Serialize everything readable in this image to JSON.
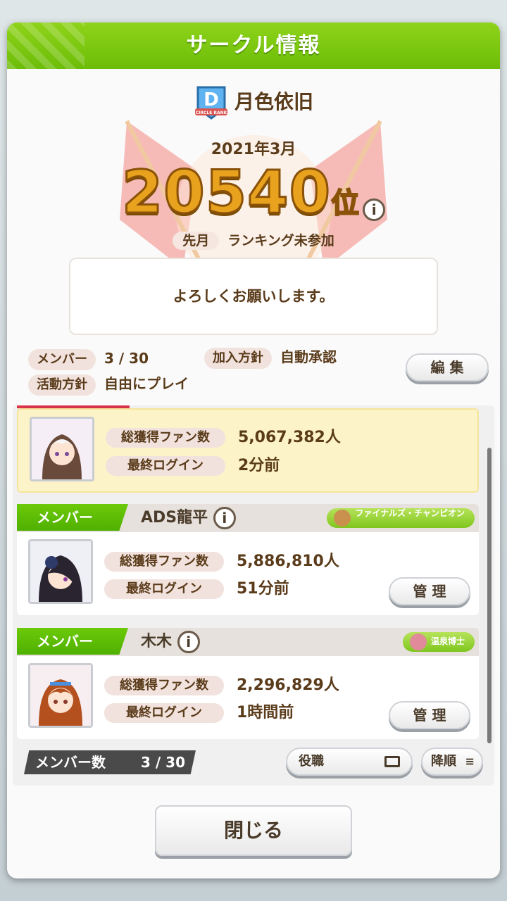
{
  "header": {
    "title": "サークル情報"
  },
  "circle": {
    "rank_badge": "D",
    "rank_badge_caption": "CIRCLE RANK",
    "name": "月色依旧",
    "month": "2021年3月",
    "rank_number": "20540",
    "rank_unit": "位",
    "last_month_label": "先月",
    "last_month_value": "ランキング未参加",
    "message": "よろしくお願いします。"
  },
  "meta": {
    "members_label": "メンバー",
    "members_value": "3 / 30",
    "policy_label": "加入方針",
    "policy_value": "自動承認",
    "activity_label": "活動方針",
    "activity_value": "自由にプレイ",
    "edit_label": "編 集"
  },
  "members": [
    {
      "fans_label": "総獲得ファン数",
      "fans": "5,067,382人",
      "login_label": "最終ログイン",
      "login": "2分前"
    },
    {
      "role": "メンバー",
      "name": "ADS龍平",
      "title": "ファイナルズ・チャンピオン",
      "fans_label": "総獲得ファン数",
      "fans": "5,886,810人",
      "login_label": "最終ログイン",
      "login": "51分前",
      "manage": "管 理"
    },
    {
      "role": "メンバー",
      "name": "木木",
      "title": "温泉博士",
      "fans_label": "総獲得ファン数",
      "fans": "2,296,829人",
      "login_label": "最終ログイン",
      "login": "1時間前",
      "manage": "管 理"
    }
  ],
  "footer": {
    "count_label": "メンバー数",
    "count_value": "3 / 30",
    "sort_role": "役職",
    "sort_order": "降順",
    "close": "閉じる"
  },
  "colors": {
    "header_green": "#6cbd08",
    "rank_gold": "#e8a21e",
    "text_brown": "#5a3b1a",
    "highlight": "#fdf3c8"
  }
}
